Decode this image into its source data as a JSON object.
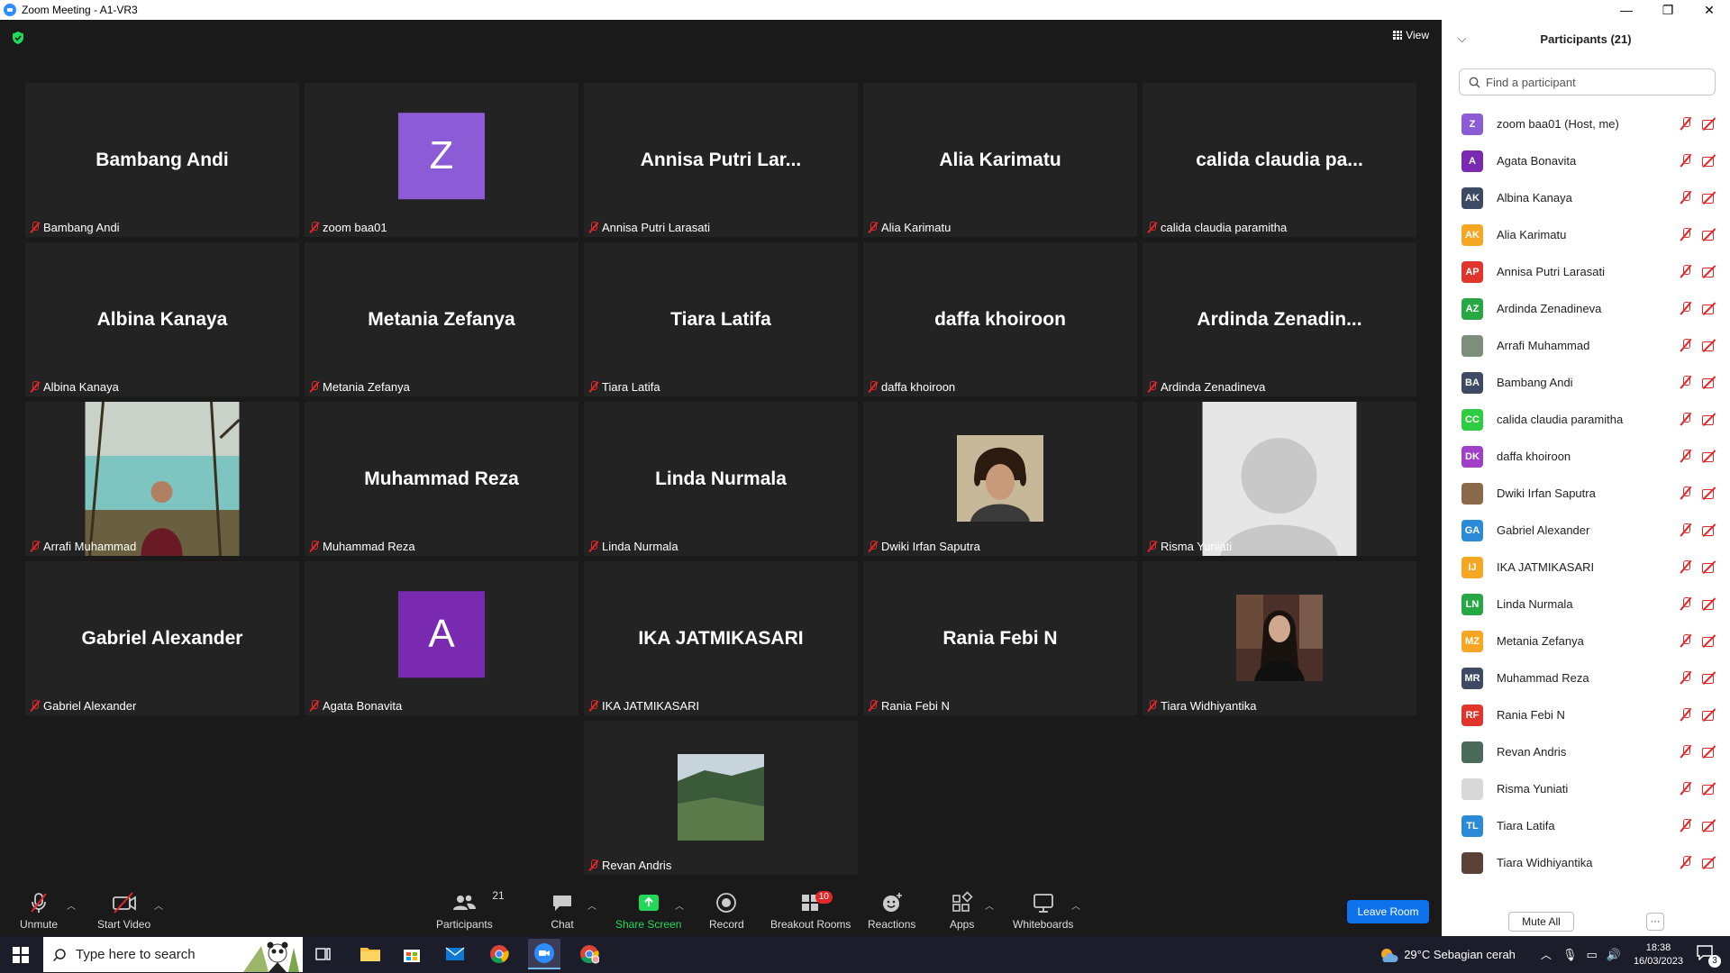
{
  "window": {
    "title": "Zoom Meeting - A1-VR3",
    "controls": [
      "—",
      "❐",
      "✕"
    ]
  },
  "meeting": {
    "view_label": "View",
    "tiles": [
      {
        "name": "Bambang Andi",
        "display": "Bambang Andi",
        "kind": "name"
      },
      {
        "name": "zoom baa01",
        "display": "Z",
        "kind": "letter",
        "color": "#8b5cd6"
      },
      {
        "name": "Annisa Putri Larasati",
        "display": "Annisa  Putri  Lar...",
        "kind": "name"
      },
      {
        "name": "Alia Karimatu",
        "display": "Alia Karimatu",
        "kind": "name"
      },
      {
        "name": "calida claudia paramitha",
        "display": "calida  claudia  pa...",
        "kind": "name"
      },
      {
        "name": "Albina Kanaya",
        "display": "Albina Kanaya",
        "kind": "name"
      },
      {
        "name": "Metania Zefanya",
        "display": "Metania Zefanya",
        "kind": "name"
      },
      {
        "name": "Tiara Latifa",
        "display": "Tiara Latifa",
        "kind": "name"
      },
      {
        "name": "daffa khoiroon",
        "display": "daffa khoiroon",
        "kind": "name"
      },
      {
        "name": "Ardinda Zenadineva",
        "display": "Ardinda  Zenadin...",
        "kind": "name"
      },
      {
        "name": "Arrafi Muhammad",
        "display": "",
        "kind": "photo-lake"
      },
      {
        "name": "Muhammad Reza",
        "display": "Muhammad Reza",
        "kind": "name"
      },
      {
        "name": "Linda Nurmala",
        "display": "Linda Nurmala",
        "kind": "name"
      },
      {
        "name": "Dwiki Irfan Saputra",
        "display": "",
        "kind": "photo-portrait"
      },
      {
        "name": "Risma Yuniati",
        "display": "",
        "kind": "photo-default"
      },
      {
        "name": "Gabriel Alexander",
        "display": "Gabriel Alexander",
        "kind": "name"
      },
      {
        "name": "Agata Bonavita",
        "display": "A",
        "kind": "letter",
        "color": "#7a2ab0"
      },
      {
        "name": "IKA JATMIKASARI",
        "display": "IKA JATMIKASARI",
        "kind": "name"
      },
      {
        "name": "Rania Febi N",
        "display": "Rania Febi N",
        "kind": "name"
      },
      {
        "name": "Tiara Widhiyantika",
        "display": "",
        "kind": "photo-dark"
      },
      {
        "name": "Revan Andris",
        "display": "",
        "kind": "photo-hill"
      }
    ]
  },
  "toolbar": {
    "unmute": "Unmute",
    "start_video": "Start Video",
    "participants": "Participants",
    "participants_count": "21",
    "chat": "Chat",
    "share_screen": "Share Screen",
    "record": "Record",
    "breakout_rooms": "Breakout Rooms",
    "breakout_badge": "10",
    "reactions": "Reactions",
    "apps": "Apps",
    "whiteboards": "Whiteboards",
    "leave": "Leave Room"
  },
  "panel": {
    "title": "Participants (21)",
    "search_placeholder": "Find a participant",
    "mute_all": "Mute All",
    "more": "···",
    "participants": [
      {
        "name": "zoom baa01 (Host, me)",
        "initials": "Z",
        "color": "#8b5cd6"
      },
      {
        "name": "Agata Bonavita",
        "initials": "A",
        "color": "#7a2ab0"
      },
      {
        "name": "Albina Kanaya",
        "initials": "AK",
        "color": "#3d4a63"
      },
      {
        "name": "Alia Karimatu",
        "initials": "AK",
        "color": "#f5a623"
      },
      {
        "name": "Annisa Putri Larasati",
        "initials": "AP",
        "color": "#e0352b"
      },
      {
        "name": "Ardinda Zenadineva",
        "initials": "AZ",
        "color": "#28a745"
      },
      {
        "name": "Arrafi Muhammad",
        "initials": "",
        "color": "#7d8f7a"
      },
      {
        "name": "Bambang Andi",
        "initials": "BA",
        "color": "#3d4a63"
      },
      {
        "name": "calida claudia paramitha",
        "initials": "CC",
        "color": "#2ecc40"
      },
      {
        "name": "daffa khoiroon",
        "initials": "DK",
        "color": "#a040c8"
      },
      {
        "name": "Dwiki Irfan Saputra",
        "initials": "",
        "color": "#8a6a4a"
      },
      {
        "name": "Gabriel Alexander",
        "initials": "GA",
        "color": "#2a8ad6"
      },
      {
        "name": "IKA JATMIKASARI",
        "initials": "IJ",
        "color": "#f5a623"
      },
      {
        "name": "Linda Nurmala",
        "initials": "LN",
        "color": "#28a745"
      },
      {
        "name": "Metania Zefanya",
        "initials": "MZ",
        "color": "#f5a623"
      },
      {
        "name": "Muhammad Reza",
        "initials": "MR",
        "color": "#3d4a63"
      },
      {
        "name": "Rania Febi N",
        "initials": "RF",
        "color": "#e0352b"
      },
      {
        "name": "Revan Andris",
        "initials": "",
        "color": "#4a6a5a"
      },
      {
        "name": "Risma Yuniati",
        "initials": "",
        "color": "#d8d8d8"
      },
      {
        "name": "Tiara Latifa",
        "initials": "TL",
        "color": "#2a8ad6"
      },
      {
        "name": "Tiara Widhiyantika",
        "initials": "",
        "color": "#5a4238"
      }
    ]
  },
  "taskbar": {
    "search_placeholder": "Type here to search",
    "weather": "29°C  Sebagian cerah",
    "time": "18:38",
    "date": "16/03/2023",
    "notifications": "3"
  }
}
